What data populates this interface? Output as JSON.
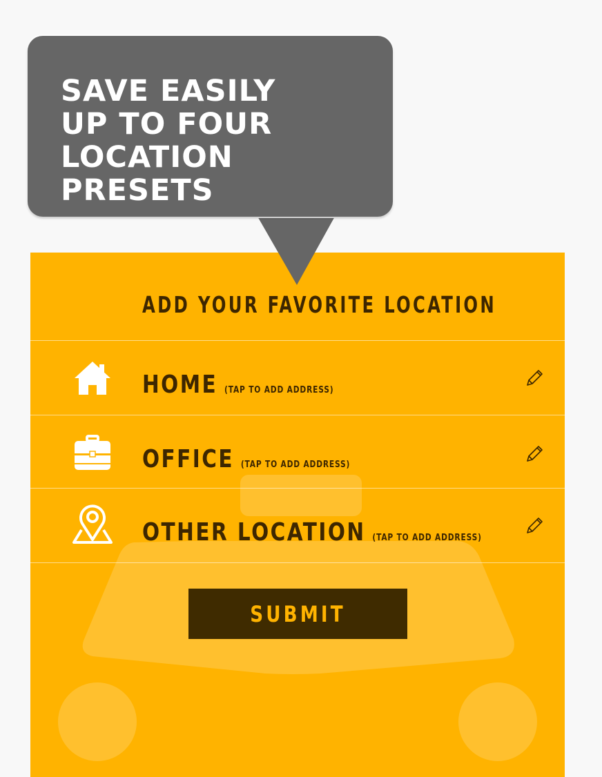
{
  "callout": {
    "lines": [
      "SAVE EASILY",
      "UP TO FOUR",
      "LOCATION PRESETS"
    ]
  },
  "panel": {
    "title": "ADD YOUR FAVORITE LOCATION",
    "rows": [
      {
        "name": "HOME",
        "hint": "(TAP TO ADD ADDRESS)",
        "icon": "home-icon",
        "action_icon": "pencil-icon"
      },
      {
        "name": "OFFICE",
        "hint": "(TAP TO ADD ADDRESS)",
        "icon": "briefcase-icon",
        "action_icon": "pencil-icon"
      },
      {
        "name": "OTHER LOCATION",
        "hint": "(TAP TO ADD ADDRESS)",
        "icon": "map-pin-icon",
        "action_icon": "pencil-icon"
      }
    ],
    "submit_label": "SUBMIT"
  },
  "colors": {
    "panel_bg": "#ffb300",
    "text_dark": "#3d2600",
    "button_bg": "#3f2b00",
    "callout_bg": "#666666"
  }
}
